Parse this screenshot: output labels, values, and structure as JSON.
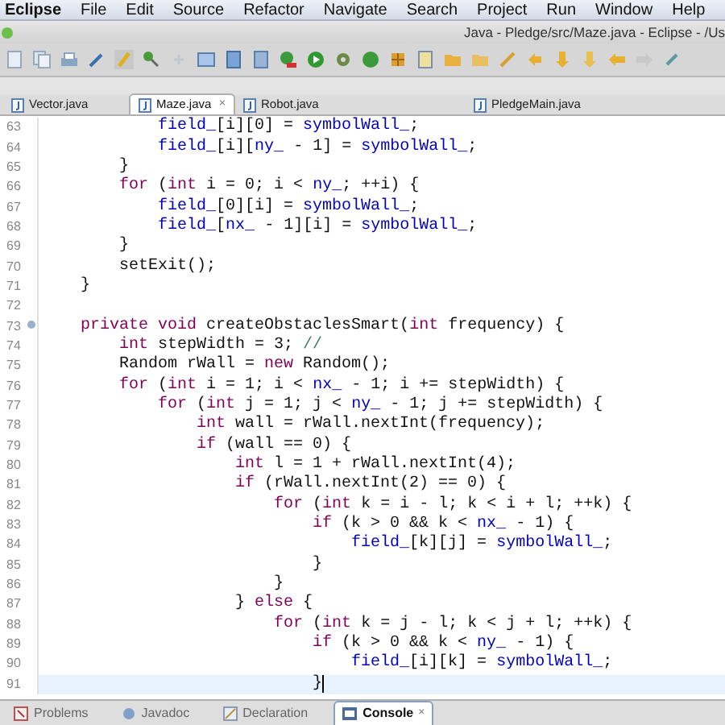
{
  "menu_bar": {
    "app": "Eclipse",
    "items": [
      "File",
      "Edit",
      "Source",
      "Refactor",
      "Navigate",
      "Search",
      "Project",
      "Run",
      "Window",
      "Help"
    ]
  },
  "window": {
    "title": "Java - Pledge/src/Maze.java - Eclipse - /Us"
  },
  "editor_tabs": [
    {
      "label": "Vector.java",
      "selected": false
    },
    {
      "label": "Maze.java",
      "selected": true,
      "close": "×"
    },
    {
      "label": "Robot.java",
      "selected": false
    },
    {
      "label": "PledgeMain.java",
      "selected": false
    }
  ],
  "editor": {
    "lines": [
      {
        "number": "63",
        "current": false,
        "folding": false,
        "segments": [
          {
            "kind": "field",
            "text": "            field_"
          },
          {
            "kind": "plain",
            "text": "[i][0] = "
          },
          {
            "kind": "field",
            "text": "symbolWall_"
          },
          {
            "kind": "plain",
            "text": ";"
          }
        ]
      },
      {
        "number": "64",
        "current": false,
        "folding": false,
        "segments": [
          {
            "kind": "field",
            "text": "            field_"
          },
          {
            "kind": "plain",
            "text": "[i]["
          },
          {
            "kind": "field",
            "text": "ny_"
          },
          {
            "kind": "plain",
            "text": " - 1] = "
          },
          {
            "kind": "field",
            "text": "symbolWall_"
          },
          {
            "kind": "plain",
            "text": ";"
          }
        ]
      },
      {
        "number": "65",
        "current": false,
        "folding": false,
        "segments": [
          {
            "kind": "plain",
            "text": "        }"
          }
        ]
      },
      {
        "number": "66",
        "current": false,
        "folding": false,
        "segments": [
          {
            "kind": "keyword",
            "text": "        for"
          },
          {
            "kind": "plain",
            "text": " ("
          },
          {
            "kind": "keyword",
            "text": "int"
          },
          {
            "kind": "plain",
            "text": " i = 0; i < "
          },
          {
            "kind": "field",
            "text": "ny_"
          },
          {
            "kind": "plain",
            "text": "; ++i) {"
          }
        ]
      },
      {
        "number": "67",
        "current": false,
        "folding": false,
        "segments": [
          {
            "kind": "field",
            "text": "            field_"
          },
          {
            "kind": "plain",
            "text": "[0][i] = "
          },
          {
            "kind": "field",
            "text": "symbolWall_"
          },
          {
            "kind": "plain",
            "text": ";"
          }
        ]
      },
      {
        "number": "68",
        "current": false,
        "folding": false,
        "segments": [
          {
            "kind": "field",
            "text": "            field_"
          },
          {
            "kind": "plain",
            "text": "["
          },
          {
            "kind": "field",
            "text": "nx_"
          },
          {
            "kind": "plain",
            "text": " - 1][i] = "
          },
          {
            "kind": "field",
            "text": "symbolWall_"
          },
          {
            "kind": "plain",
            "text": ";"
          }
        ]
      },
      {
        "number": "69",
        "current": false,
        "folding": false,
        "segments": [
          {
            "kind": "plain",
            "text": "        }"
          }
        ]
      },
      {
        "number": "70",
        "current": false,
        "folding": false,
        "segments": [
          {
            "kind": "plain",
            "text": "        setExit();"
          }
        ]
      },
      {
        "number": "71",
        "current": false,
        "folding": false,
        "segments": [
          {
            "kind": "plain",
            "text": "    }"
          }
        ]
      },
      {
        "number": "72",
        "current": false,
        "folding": false
      },
      {
        "number": "73",
        "current": false,
        "folding": true,
        "segments": [
          {
            "kind": "keyword",
            "text": "    private"
          },
          {
            "kind": "keyword",
            "text": " void"
          },
          {
            "kind": "plain",
            "text": " createObstaclesSmart("
          },
          {
            "kind": "keyword",
            "text": "int"
          },
          {
            "kind": "plain",
            "text": " frequency) {"
          }
        ]
      },
      {
        "number": "74",
        "current": false,
        "folding": false,
        "segments": [
          {
            "kind": "keyword",
            "text": "        int"
          },
          {
            "kind": "plain",
            "text": " stepWidth = 3; "
          },
          {
            "kind": "comment",
            "text": "//"
          }
        ]
      },
      {
        "number": "75",
        "current": false,
        "folding": false,
        "segments": [
          {
            "kind": "plain",
            "text": "        Random rWall = "
          },
          {
            "kind": "keyword",
            "text": "new"
          },
          {
            "kind": "plain",
            "text": " Random();"
          }
        ]
      },
      {
        "number": "76",
        "current": false,
        "folding": false,
        "segments": [
          {
            "kind": "keyword",
            "text": "        for"
          },
          {
            "kind": "plain",
            "text": " ("
          },
          {
            "kind": "keyword",
            "text": "int"
          },
          {
            "kind": "plain",
            "text": " i = 1; i < "
          },
          {
            "kind": "field",
            "text": "nx_"
          },
          {
            "kind": "plain",
            "text": " - 1; i += stepWidth) {"
          }
        ]
      },
      {
        "number": "77",
        "current": false,
        "folding": false,
        "segments": [
          {
            "kind": "keyword",
            "text": "            for"
          },
          {
            "kind": "plain",
            "text": " ("
          },
          {
            "kind": "keyword",
            "text": "int"
          },
          {
            "kind": "plain",
            "text": " j = 1; j < "
          },
          {
            "kind": "field",
            "text": "ny_"
          },
          {
            "kind": "plain",
            "text": " - 1; j += stepWidth) {"
          }
        ]
      },
      {
        "number": "78",
        "current": false,
        "folding": false,
        "segments": [
          {
            "kind": "keyword",
            "text": "                int"
          },
          {
            "kind": "plain",
            "text": " wall = rWall.nextInt(frequency);"
          }
        ]
      },
      {
        "number": "79",
        "current": false,
        "folding": false,
        "segments": [
          {
            "kind": "keyword",
            "text": "                if"
          },
          {
            "kind": "plain",
            "text": " (wall == 0) {"
          }
        ]
      },
      {
        "number": "80",
        "current": false,
        "folding": false,
        "segments": [
          {
            "kind": "keyword",
            "text": "                    int"
          },
          {
            "kind": "plain",
            "text": " l = 1 + rWall.nextInt(4);"
          }
        ]
      },
      {
        "number": "81",
        "current": false,
        "folding": false,
        "segments": [
          {
            "kind": "keyword",
            "text": "                    if"
          },
          {
            "kind": "plain",
            "text": " (rWall.nextInt(2) == 0) {"
          }
        ]
      },
      {
        "number": "82",
        "current": false,
        "folding": false,
        "segments": [
          {
            "kind": "keyword",
            "text": "                        for"
          },
          {
            "kind": "plain",
            "text": " ("
          },
          {
            "kind": "keyword",
            "text": "int"
          },
          {
            "kind": "plain",
            "text": " k = i - l; k < i + l; ++k) {"
          }
        ]
      },
      {
        "number": "83",
        "current": false,
        "folding": false,
        "segments": [
          {
            "kind": "keyword",
            "text": "                            if"
          },
          {
            "kind": "plain",
            "text": " (k > 0 && k < "
          },
          {
            "kind": "field",
            "text": "nx_"
          },
          {
            "kind": "plain",
            "text": " - 1) {"
          }
        ]
      },
      {
        "number": "84",
        "current": false,
        "folding": false,
        "segments": [
          {
            "kind": "field",
            "text": "                                field_"
          },
          {
            "kind": "plain",
            "text": "[k][j] = "
          },
          {
            "kind": "field",
            "text": "symbolWall_"
          },
          {
            "kind": "plain",
            "text": ";"
          }
        ]
      },
      {
        "number": "85",
        "current": false,
        "folding": false,
        "segments": [
          {
            "kind": "plain",
            "text": "                            }"
          }
        ]
      },
      {
        "number": "86",
        "current": false,
        "folding": false,
        "segments": [
          {
            "kind": "plain",
            "text": "                        }"
          }
        ]
      },
      {
        "number": "87",
        "current": false,
        "folding": false,
        "segments": [
          {
            "kind": "plain",
            "text": "                    } "
          },
          {
            "kind": "keyword",
            "text": "else"
          },
          {
            "kind": "plain",
            "text": " {"
          }
        ]
      },
      {
        "number": "88",
        "current": false,
        "folding": false,
        "segments": [
          {
            "kind": "keyword",
            "text": "                        for"
          },
          {
            "kind": "plain",
            "text": " ("
          },
          {
            "kind": "keyword",
            "text": "int"
          },
          {
            "kind": "plain",
            "text": " k = j - l; k < j + l; ++k) {"
          }
        ]
      },
      {
        "number": "89",
        "current": false,
        "folding": false,
        "segments": [
          {
            "kind": "keyword",
            "text": "                            if"
          },
          {
            "kind": "plain",
            "text": " (k > 0 && k < "
          },
          {
            "kind": "field",
            "text": "ny_"
          },
          {
            "kind": "plain",
            "text": " - 1) {"
          }
        ]
      },
      {
        "number": "90",
        "current": false,
        "folding": false,
        "segments": [
          {
            "kind": "field",
            "text": "                                field_"
          },
          {
            "kind": "plain",
            "text": "[i][k] = "
          },
          {
            "kind": "field",
            "text": "symbolWall_"
          },
          {
            "kind": "plain",
            "text": ";"
          }
        ]
      },
      {
        "number": "91",
        "current": true,
        "folding": false,
        "segments": [
          {
            "kind": "plain",
            "text": "                            }"
          }
        ]
      }
    ]
  },
  "bottom_tabs": [
    {
      "label": "Problems",
      "selected": false
    },
    {
      "label": "Javadoc",
      "selected": false
    },
    {
      "label": "Declaration",
      "selected": false
    },
    {
      "label": "Console",
      "selected": true,
      "close": "×"
    }
  ]
}
